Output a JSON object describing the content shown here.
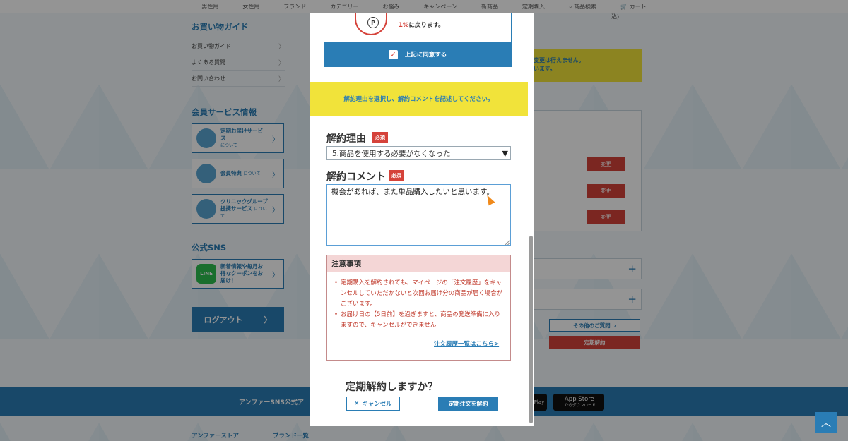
{
  "top_nav": {
    "items": [
      "男性用",
      "女性用",
      "ブランド",
      "カテゴリー",
      "お悩み",
      "キャンペーン",
      "新商品",
      "定期購入",
      "商品検索",
      "カート"
    ],
    "search_icon": "search-icon",
    "cart_icon": "cart-icon"
  },
  "left_sidebar": {
    "guide_title": "お買い物ガイド",
    "guide_items": [
      "お買い物ガイド",
      "よくある質問",
      "お問い合わせ"
    ],
    "member_title": "会員サービス情報",
    "services": [
      {
        "label": "定期お届けサービス",
        "sub": "について"
      },
      {
        "label": "会員特典",
        "sub": "について"
      },
      {
        "label": "クリニックグループ提携サービス",
        "sub": "について"
      }
    ],
    "sns_title": "公式SNS",
    "line_icon_text": "LINE",
    "line_text": "新着情報や毎月お得なクーポンをお届け！",
    "logout": "ログアウト"
  },
  "right_panel": {
    "price_suffix": "込)",
    "notice_line1": "変更は行えません。",
    "notice_line2": "います。",
    "change_label": "変更",
    "other_question": "その他のご質問",
    "cancel_subscription": "定期解約"
  },
  "footer": {
    "sns_text": "アンファーSNS公式ア",
    "google_play_suffix": "Play",
    "app_store": "App Store",
    "app_store_sub": "からダウンロード",
    "links": [
      "アンファーストア",
      "ブランド一覧"
    ]
  },
  "modal": {
    "refund_pct": "1%",
    "refund_rest": "に戻ります。",
    "agree_label": "上記に同意する",
    "instruction": "解約理由を選択し、解約コメントを記述してください。",
    "reason_label": "解約理由",
    "required": "必須",
    "reason_selected": "5.商品を使用する必要がなくなった",
    "comment_label": "解約コメント",
    "comment_value": "機会があれば、また単品購入したいと思います。",
    "notes_title": "注意事項",
    "notes": [
      "定期購入を解約されても、マイページの「注文履歴」をキャンセルしていただかないと次回お届け分の商品が届く場合がございます。",
      "お届け日の【5日前】を過ぎますと、商品の発送準備に入りますので、キャンセルができません"
    ],
    "history_link": "注文履歴一覧はこちら>",
    "confirm_question": "定期解約しますか？",
    "cancel_button": "キャンセル",
    "confirm_button": "定期注文を解約"
  },
  "colors": {
    "brand_blue": "#2a7db5",
    "alert_red": "#d5423a",
    "highlight_yellow": "#f1e33a"
  }
}
